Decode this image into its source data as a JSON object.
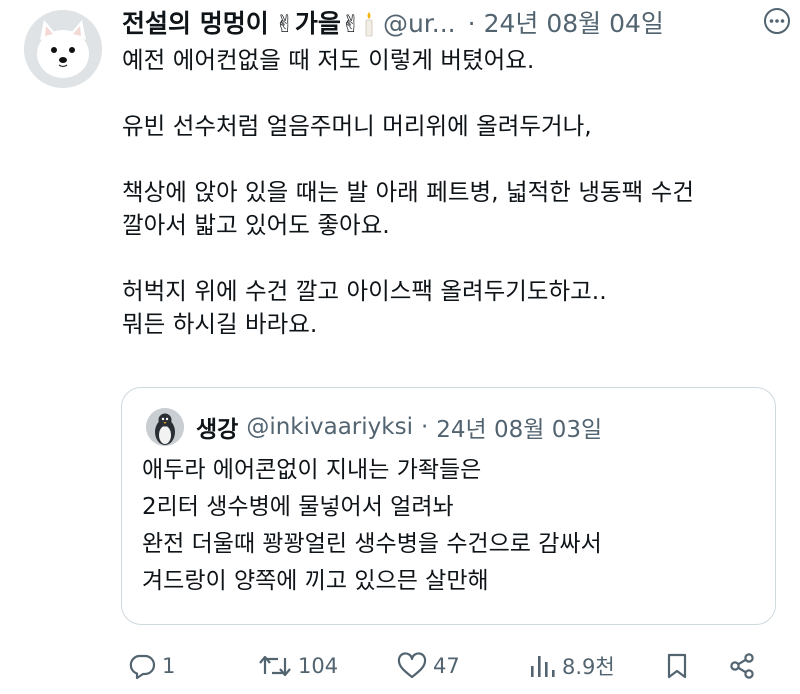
{
  "author": {
    "display_name": "전설의 멍멍이",
    "name_suffix": "가을",
    "handle": "@ur...",
    "separator": "·",
    "date": "24년 08월 04일",
    "avatar_icon": "white-dog-avatar"
  },
  "tweet": {
    "lines": [
      "예전 에어컨없을 때 저도 이렇게 버텼어요.",
      "",
      "유빈 선수처럼 얼음주머니 머리위에 올려두거나,",
      "",
      "책상에 앉아 있을 때는 발 아래 페트병, 넓적한 냉동팩 수건",
      "깔아서 밟고 있어도 좋아요.",
      "",
      "허벅지 위에 수건 깔고 아이스팩 올려두기도하고..",
      "뭐든 하시길 바라요."
    ]
  },
  "quote": {
    "display_name": "생강",
    "handle": "@inkivaariyksi",
    "separator": "·",
    "date": "24년 08월 03일",
    "avatar_icon": "penguin-avatar",
    "lines": [
      "애두라 에어콘없이 지내는 가좍들은",
      "2리터 생수병에 물넣어서 얼려놔",
      "완전 더울때 꽝꽝얼린 생수병을 수건으로 감싸서",
      "겨드랑이 양쪽에 끼고 있으믄 살만해"
    ]
  },
  "actions": {
    "reply_count": "1",
    "retweet_count": "104",
    "like_count": "47",
    "view_count": "8.9천",
    "icons": [
      "reply-icon",
      "retweet-icon",
      "like-icon",
      "views-icon",
      "bookmark-icon",
      "share-icon"
    ]
  },
  "colors": {
    "text": "#0f1419",
    "muted": "#536471",
    "border": "#cfd9de"
  }
}
